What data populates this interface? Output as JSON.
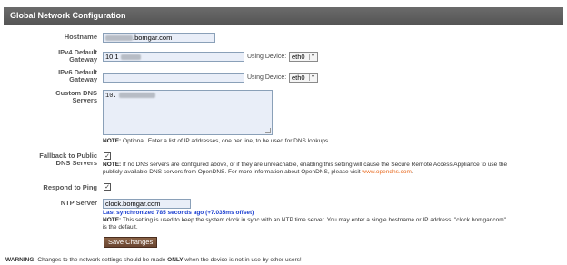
{
  "header": {
    "title": "Global Network Configuration"
  },
  "hostname": {
    "label": "Hostname",
    "value_suffix": ".bomgar.com"
  },
  "ipv4": {
    "label_line1": "IPv4 Default",
    "label_line2": "Gateway",
    "value_prefix": "10.1",
    "device_label": "Using Device:",
    "device_value": "eth0"
  },
  "ipv6": {
    "label_line1": "IPv6 Default",
    "label_line2": "Gateway",
    "value": "",
    "device_label": "Using Device:",
    "device_value": "eth0"
  },
  "dns": {
    "label_line1": "Custom DNS",
    "label_line2": "Servers",
    "value_prefix": "10.",
    "note_bold": "NOTE:",
    "note_text": " Optional. Enter a list of IP addresses, one per line, to be used for DNS lookups."
  },
  "fallback": {
    "label_line1": "Fallback to Public",
    "label_line2": "DNS Servers",
    "checked": true,
    "note_bold": "NOTE:",
    "note_line1": " If no DNS servers are configured above, or if they are unreachable, enabling this setting will cause the Secure Remote Access Appliance to use the",
    "note_line2": "publicly-available DNS servers from OpenDNS. For more information about OpenDNS, please visit ",
    "note_link": "www.opendns.com",
    "note_end": "."
  },
  "ping": {
    "label": "Respond to Ping",
    "checked": true
  },
  "ntp": {
    "label": "NTP Server",
    "value": "clock.bomgar.com",
    "sync_text": "Last synchronized 785 seconds ago (+7.035ms offset)",
    "note_bold": "NOTE:",
    "note_line1": " This setting is used to keep the system clock in sync with an NTP time server. You may enter a single hostname or IP address. \"clock.bomgar.com\"",
    "note_line2": "is the default."
  },
  "actions": {
    "save_label": "Save Changes"
  },
  "warning": {
    "bold1": "WARNING:",
    "text1": " Changes to the network settings should be made ",
    "bold2": "ONLY",
    "text2": " when the device is not in use by other users!"
  },
  "colors": {
    "link": "#e8691e",
    "sync": "#1a3ed0",
    "header_bg": "#5e5e5e",
    "save_bg": "#7a543c"
  }
}
